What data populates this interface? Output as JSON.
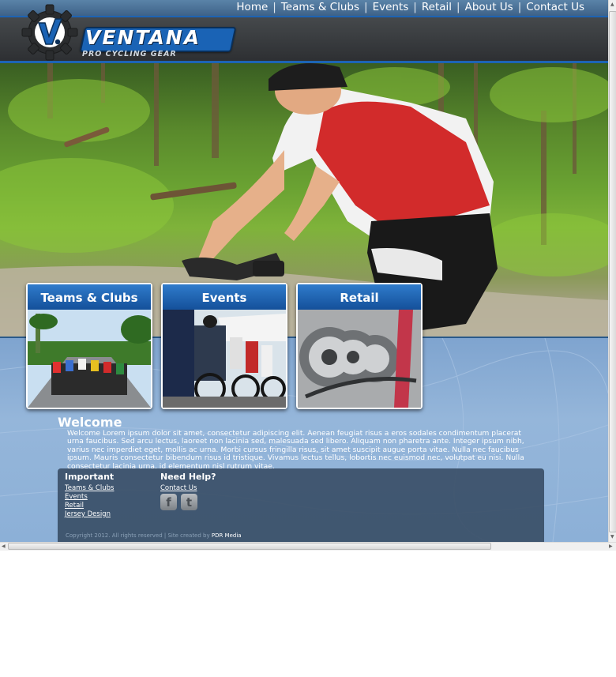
{
  "header": {
    "brand_name": "VENTANA",
    "brand_tagline": "PRO CYCLING GEAR",
    "logo_letter": "V.",
    "nav": [
      {
        "label": "Home"
      },
      {
        "label": "Teams & Clubs"
      },
      {
        "label": "Events"
      },
      {
        "label": "Retail"
      },
      {
        "label": "About Us"
      },
      {
        "label": "Contact Us"
      }
    ],
    "nav_separator": "|"
  },
  "cards": [
    {
      "title": "Teams & Clubs",
      "image": "road-race-peloton"
    },
    {
      "title": "Events",
      "image": "riders-at-start-line"
    },
    {
      "title": "Retail",
      "image": "bike-cassette-and-chain"
    }
  ],
  "welcome": {
    "title": "Welcome",
    "body": "Welcome Lorem ipsum dolor sit amet, consectetur adipiscing elit. Aenean feugiat risus a eros sodales condimentum placerat urna faucibus. Sed arcu lectus, laoreet non lacinia sed, malesuada sed libero. Aliquam non pharetra ante. Integer ipsum nibh, varius nec imperdiet eget, mollis ac urna. Morbi cursus fringilla risus, sit amet suscipit augue porta vitae. Nulla nec faucibus ipsum. Mauris consectetur bibendum risus id tristique. Vivamus lectus tellus, lobortis nec euismod nec, volutpat eu nisi. Nulla consectetur lacinia urna, id elementum nisl rutrum vitae."
  },
  "footer": {
    "important_title": "Important",
    "important_links": [
      "Teams & Clubs",
      "Events",
      "Retail",
      "Jersey Design"
    ],
    "help_title": "Need Help?",
    "help_link": "Contact Us",
    "social": [
      "facebook-icon",
      "twitter-icon"
    ],
    "copyright": "Copyright 2012. All rights reserved  |  Site created by",
    "credit": "PDR Media"
  },
  "colors": {
    "accent_blue": "#1d64b4",
    "header_dark": "#3a3d40",
    "lower_bg": "#8fb1d6",
    "footer_bg": "#364a62"
  }
}
